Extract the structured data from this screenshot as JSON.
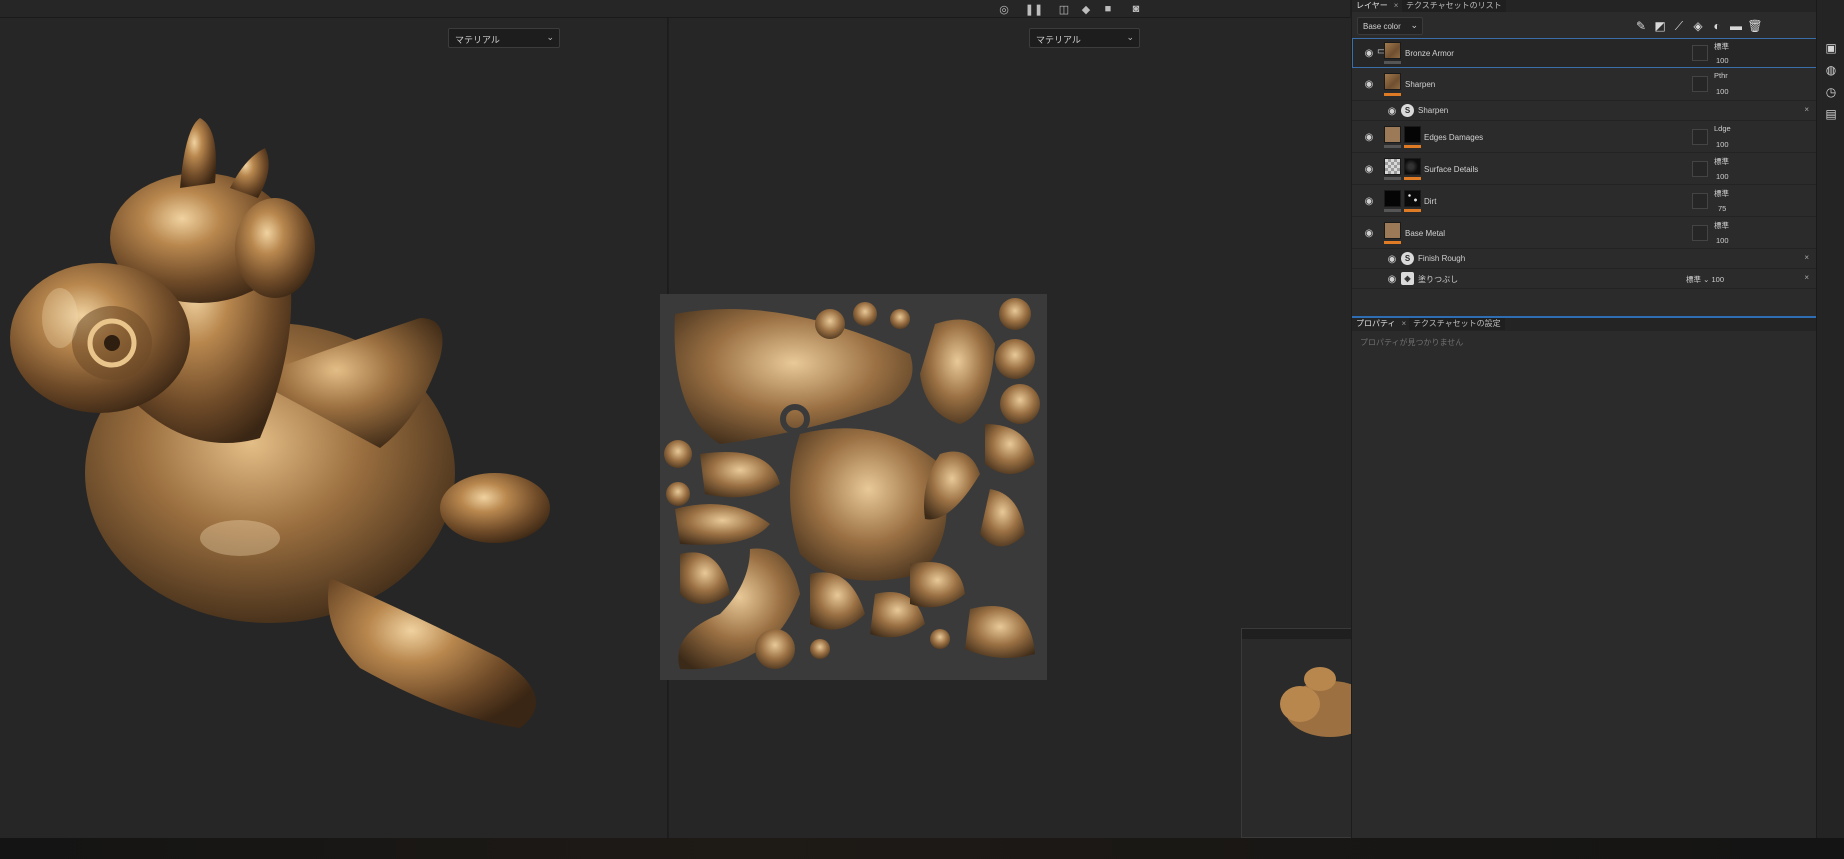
{
  "viewport3d": {
    "material_select": "マテリアル"
  },
  "viewport2d": {
    "material_select": "マテリアル"
  },
  "panel_tabs": [
    {
      "label": "レイヤー",
      "active": true
    },
    {
      "label": "テクスチャセットのリスト",
      "active": false
    }
  ],
  "channel": {
    "value": "Base color"
  },
  "layers": [
    {
      "name": "Bronze Armor",
      "blend": "標準",
      "opacity": "100",
      "selected": true
    },
    {
      "name": "Sharpen",
      "blend": "Pthr",
      "opacity": "100"
    },
    {
      "name": "Edges Damages",
      "blend": "Ldge",
      "opacity": "100"
    },
    {
      "name": "Surface Details",
      "blend": "標準",
      "opacity": "100"
    },
    {
      "name": "Dirt",
      "blend": "標準",
      "opacity": "75"
    },
    {
      "name": "Base Metal",
      "blend": "標準",
      "opacity": "100"
    }
  ],
  "effects": [
    {
      "name": "Sharpen",
      "icon": "filter-icon"
    },
    {
      "name": "Finish Rough",
      "icon": "filter-icon"
    },
    {
      "name": "塗りつぶし",
      "icon": "fill-icon",
      "blend": "標準",
      "opacity": "100"
    }
  ],
  "properties": {
    "tabs": [
      {
        "label": "プロパティ"
      },
      {
        "label": "テクスチャセットの設定"
      }
    ],
    "empty_text": "プロパティが見つかりません"
  },
  "colors": {
    "accent": "#e07b25",
    "selection": "#3a6ea8",
    "panel_bg": "#2b2b2b",
    "viewport_bg": "#262626",
    "bronze": "#b08552"
  }
}
